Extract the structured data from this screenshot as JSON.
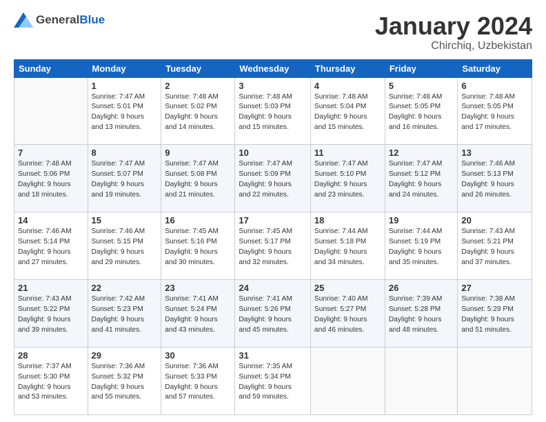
{
  "header": {
    "logo_general": "General",
    "logo_blue": "Blue",
    "title": "January 2024",
    "subtitle": "Chirchiq, Uzbekistan"
  },
  "days": [
    "Sunday",
    "Monday",
    "Tuesday",
    "Wednesday",
    "Thursday",
    "Friday",
    "Saturday"
  ],
  "weeks": [
    [
      {
        "date": "",
        "info": ""
      },
      {
        "date": "1",
        "info": "Sunrise: 7:47 AM\nSunset: 5:01 PM\nDaylight: 9 hours\nand 13 minutes."
      },
      {
        "date": "2",
        "info": "Sunrise: 7:48 AM\nSunset: 5:02 PM\nDaylight: 9 hours\nand 14 minutes."
      },
      {
        "date": "3",
        "info": "Sunrise: 7:48 AM\nSunset: 5:03 PM\nDaylight: 9 hours\nand 15 minutes."
      },
      {
        "date": "4",
        "info": "Sunrise: 7:48 AM\nSunset: 5:04 PM\nDaylight: 9 hours\nand 15 minutes."
      },
      {
        "date": "5",
        "info": "Sunrise: 7:48 AM\nSunset: 5:05 PM\nDaylight: 9 hours\nand 16 minutes."
      },
      {
        "date": "6",
        "info": "Sunrise: 7:48 AM\nSunset: 5:05 PM\nDaylight: 9 hours\nand 17 minutes."
      }
    ],
    [
      {
        "date": "7",
        "info": "Sunrise: 7:48 AM\nSunset: 5:06 PM\nDaylight: 9 hours\nand 18 minutes."
      },
      {
        "date": "8",
        "info": "Sunrise: 7:47 AM\nSunset: 5:07 PM\nDaylight: 9 hours\nand 19 minutes."
      },
      {
        "date": "9",
        "info": "Sunrise: 7:47 AM\nSunset: 5:08 PM\nDaylight: 9 hours\nand 21 minutes."
      },
      {
        "date": "10",
        "info": "Sunrise: 7:47 AM\nSunset: 5:09 PM\nDaylight: 9 hours\nand 22 minutes."
      },
      {
        "date": "11",
        "info": "Sunrise: 7:47 AM\nSunset: 5:10 PM\nDaylight: 9 hours\nand 23 minutes."
      },
      {
        "date": "12",
        "info": "Sunrise: 7:47 AM\nSunset: 5:12 PM\nDaylight: 9 hours\nand 24 minutes."
      },
      {
        "date": "13",
        "info": "Sunrise: 7:46 AM\nSunset: 5:13 PM\nDaylight: 9 hours\nand 26 minutes."
      }
    ],
    [
      {
        "date": "14",
        "info": "Sunrise: 7:46 AM\nSunset: 5:14 PM\nDaylight: 9 hours\nand 27 minutes."
      },
      {
        "date": "15",
        "info": "Sunrise: 7:46 AM\nSunset: 5:15 PM\nDaylight: 9 hours\nand 29 minutes."
      },
      {
        "date": "16",
        "info": "Sunrise: 7:45 AM\nSunset: 5:16 PM\nDaylight: 9 hours\nand 30 minutes."
      },
      {
        "date": "17",
        "info": "Sunrise: 7:45 AM\nSunset: 5:17 PM\nDaylight: 9 hours\nand 32 minutes."
      },
      {
        "date": "18",
        "info": "Sunrise: 7:44 AM\nSunset: 5:18 PM\nDaylight: 9 hours\nand 34 minutes."
      },
      {
        "date": "19",
        "info": "Sunrise: 7:44 AM\nSunset: 5:19 PM\nDaylight: 9 hours\nand 35 minutes."
      },
      {
        "date": "20",
        "info": "Sunrise: 7:43 AM\nSunset: 5:21 PM\nDaylight: 9 hours\nand 37 minutes."
      }
    ],
    [
      {
        "date": "21",
        "info": "Sunrise: 7:43 AM\nSunset: 5:22 PM\nDaylight: 9 hours\nand 39 minutes."
      },
      {
        "date": "22",
        "info": "Sunrise: 7:42 AM\nSunset: 5:23 PM\nDaylight: 9 hours\nand 41 minutes."
      },
      {
        "date": "23",
        "info": "Sunrise: 7:41 AM\nSunset: 5:24 PM\nDaylight: 9 hours\nand 43 minutes."
      },
      {
        "date": "24",
        "info": "Sunrise: 7:41 AM\nSunset: 5:26 PM\nDaylight: 9 hours\nand 45 minutes."
      },
      {
        "date": "25",
        "info": "Sunrise: 7:40 AM\nSunset: 5:27 PM\nDaylight: 9 hours\nand 46 minutes."
      },
      {
        "date": "26",
        "info": "Sunrise: 7:39 AM\nSunset: 5:28 PM\nDaylight: 9 hours\nand 48 minutes."
      },
      {
        "date": "27",
        "info": "Sunrise: 7:38 AM\nSunset: 5:29 PM\nDaylight: 9 hours\nand 51 minutes."
      }
    ],
    [
      {
        "date": "28",
        "info": "Sunrise: 7:37 AM\nSunset: 5:30 PM\nDaylight: 9 hours\nand 53 minutes."
      },
      {
        "date": "29",
        "info": "Sunrise: 7:36 AM\nSunset: 5:32 PM\nDaylight: 9 hours\nand 55 minutes."
      },
      {
        "date": "30",
        "info": "Sunrise: 7:36 AM\nSunset: 5:33 PM\nDaylight: 9 hours\nand 57 minutes."
      },
      {
        "date": "31",
        "info": "Sunrise: 7:35 AM\nSunset: 5:34 PM\nDaylight: 9 hours\nand 59 minutes."
      },
      {
        "date": "",
        "info": ""
      },
      {
        "date": "",
        "info": ""
      },
      {
        "date": "",
        "info": ""
      }
    ]
  ]
}
